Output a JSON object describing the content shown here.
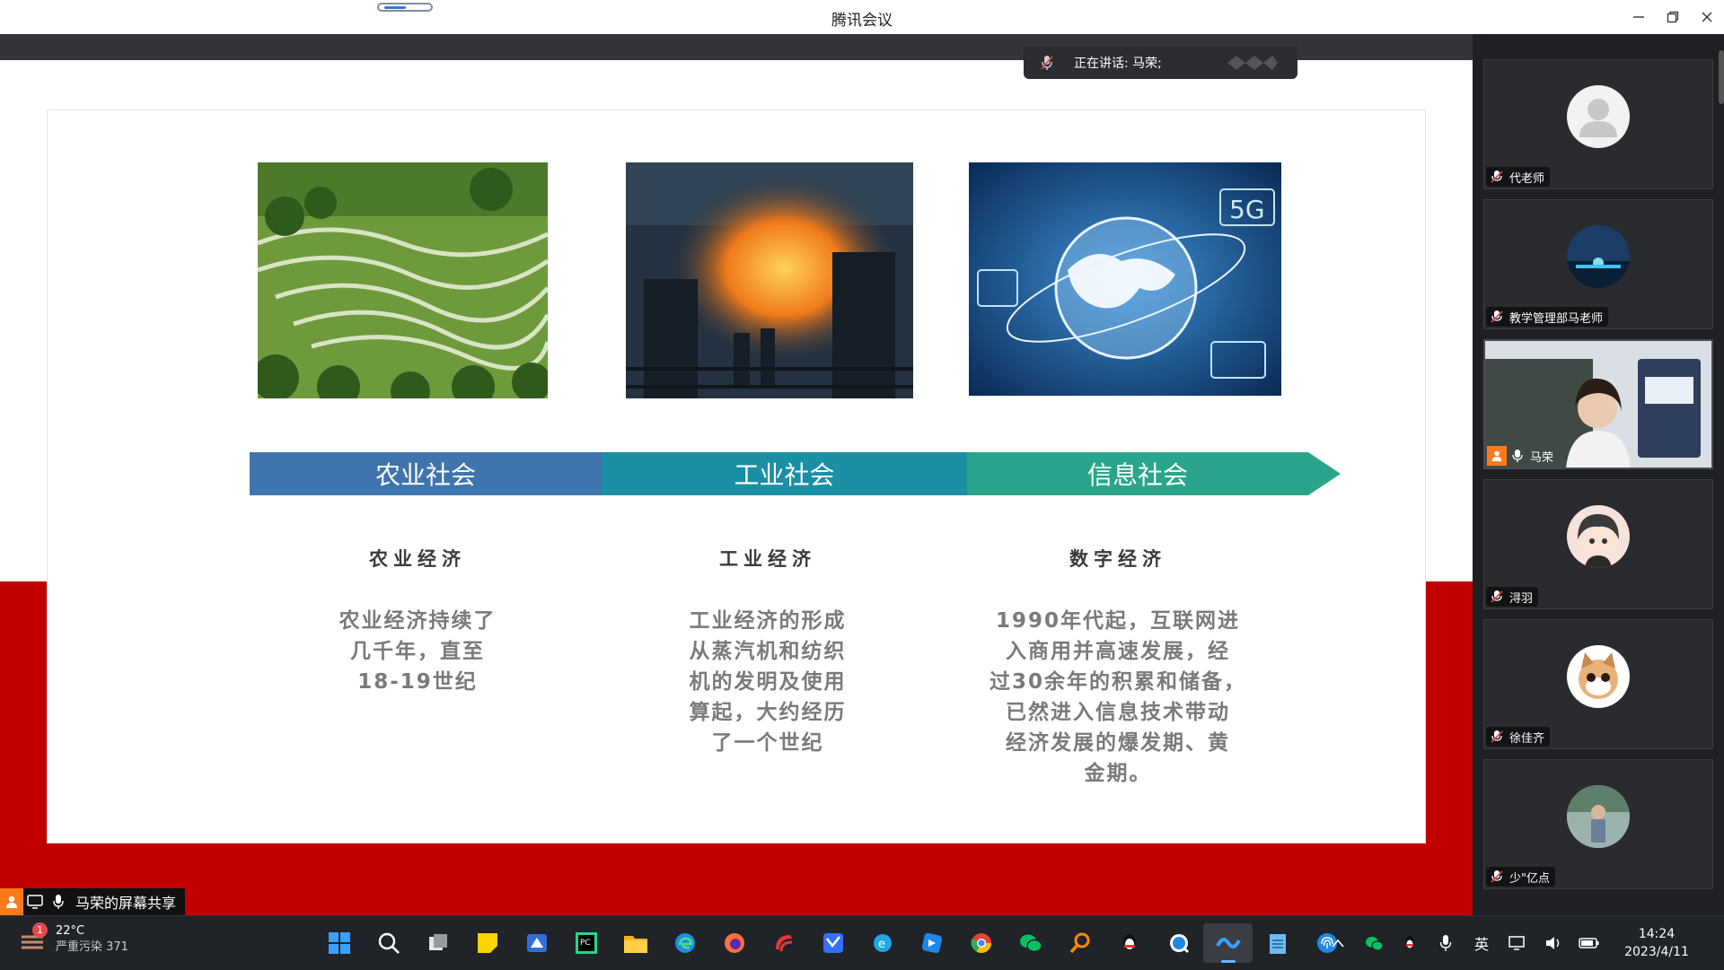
{
  "window": {
    "title": "腾讯会议",
    "controls": [
      "minimize-icon",
      "restore-icon",
      "close-icon"
    ]
  },
  "speaking_banner": {
    "text": "正在讲话: 马荣;"
  },
  "slide": {
    "bands": [
      "农业社会",
      "工业社会",
      "信息社会"
    ],
    "columns": [
      {
        "title": "农业经济",
        "lines": [
          "农业经济持续了",
          "几千年，直至",
          "18-19世纪"
        ]
      },
      {
        "title": "工业经济",
        "lines": [
          "工业经济的形成",
          "从蒸汽机和纺织",
          "机的发明及使用",
          "算起，大约经历",
          "了一个世纪"
        ]
      },
      {
        "title": "数字经济",
        "lines": [
          "1990年代起，互联网进",
          "入商用并高速发展，经",
          "过30余年的积累和储备，",
          "已然进入信息技术带动",
          "经济发展的爆发期、黄",
          "金期。"
        ]
      }
    ],
    "colors": {
      "band1": "#3f74ae",
      "band2": "#1b8fa4",
      "band3": "#2aa58b",
      "red_background": "#c00000"
    }
  },
  "participants": [
    {
      "name": "代老师",
      "muted": true,
      "avatar": "default-avatar-icon"
    },
    {
      "name": "教学管理部马老师",
      "muted": true,
      "avatar": "photo-avatar"
    },
    {
      "name": "马荣",
      "muted": false,
      "host": true,
      "video": true
    },
    {
      "name": "浔羽",
      "muted": true,
      "avatar": "cartoon-avatar"
    },
    {
      "name": "徐佳齐",
      "muted": true,
      "avatar": "cat-avatar"
    },
    {
      "name": "少\"亿点",
      "muted": true,
      "avatar": "photo-avatar"
    }
  ],
  "share_bar": {
    "label": "马荣的屏幕共享"
  },
  "taskbar": {
    "weather_temp": "22°C",
    "weather_desc": "严重污染 371",
    "weather_badge": "1",
    "ime": "英",
    "time": "14:24",
    "date": "2023/4/11",
    "apps": [
      "start-icon",
      "search-icon",
      "task-view-icon",
      "sticky-notes-icon",
      "tencent-meeting-alt-icon",
      "pycharm-icon",
      "file-explorer-icon",
      "edge-icon",
      "firefox-icon",
      "wps-icon",
      "feishu-icon",
      "ie-icon",
      "lark-icon",
      "chrome-icon",
      "wechat-icon",
      "search-tool-icon",
      "qq-icon",
      "quicklook-icon",
      "tencent-meeting-icon",
      "notepad-icon",
      "fingerprint-icon"
    ]
  }
}
